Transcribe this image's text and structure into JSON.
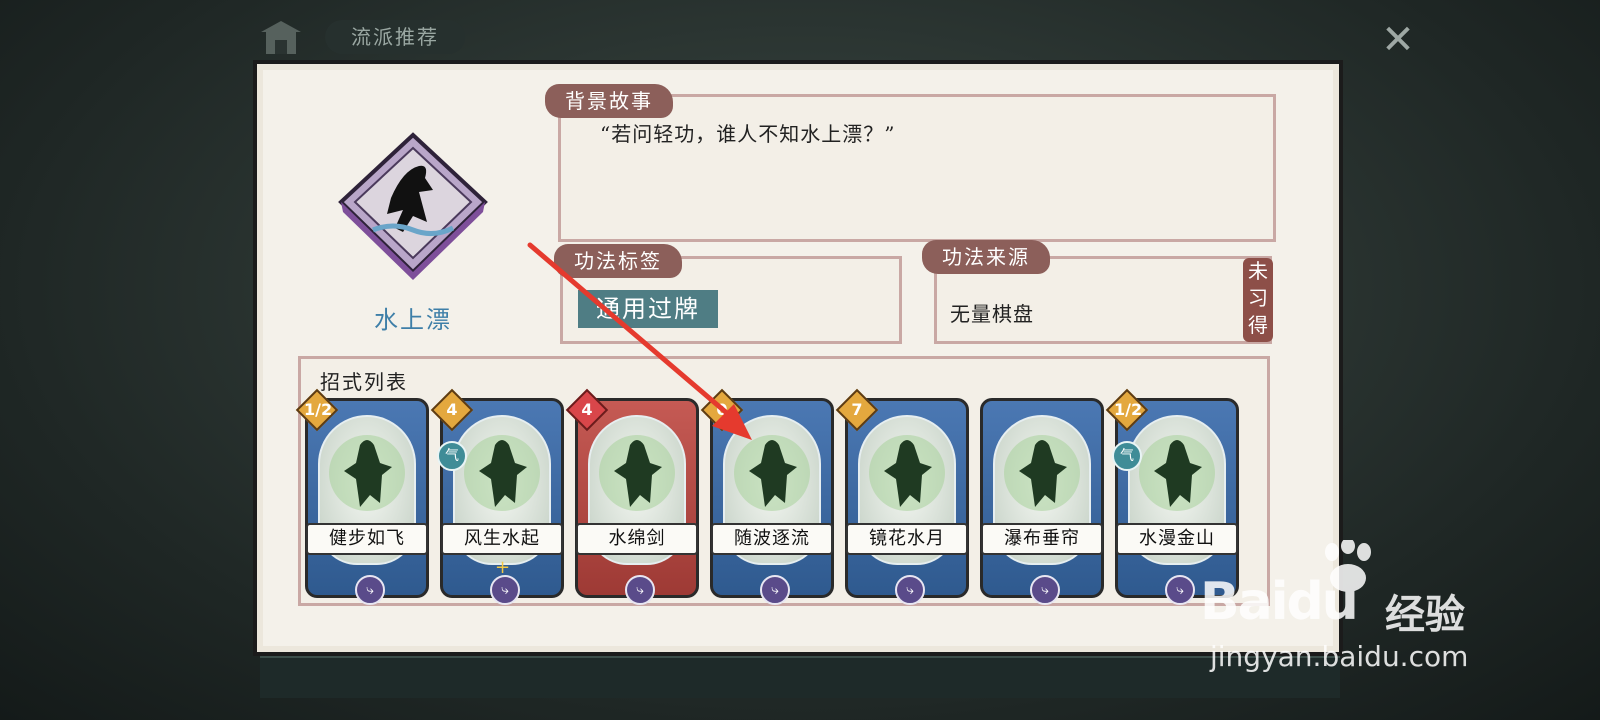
{
  "top_tab": {
    "label": "流派推荐"
  },
  "close_button": {
    "symbol": "✕"
  },
  "skill": {
    "name": "水上漂",
    "story_label": "背景故事",
    "story_text": "“若问轻功，谁人不知水上漂？”",
    "tags_label": "功法标签",
    "tag": "通用过牌",
    "source_label": "功法来源",
    "source": "无量棋盘",
    "status": "未习得"
  },
  "moves": {
    "title": "招式列表",
    "cards": [
      {
        "name": "健步如飞",
        "cost": "1/2",
        "color": "blue",
        "qi": false,
        "plus": false
      },
      {
        "name": "风生水起",
        "cost": "4",
        "color": "blue",
        "qi": true,
        "plus": true
      },
      {
        "name": "水绵剑",
        "cost": "4",
        "color": "red",
        "qi": false,
        "plus": false
      },
      {
        "name": "随波逐流",
        "cost": "0",
        "color": "blue",
        "qi": false,
        "plus": false
      },
      {
        "name": "镜花水月",
        "cost": "7",
        "color": "blue",
        "qi": false,
        "plus": false
      },
      {
        "name": "瀑布垂帘",
        "cost": "",
        "color": "blue",
        "qi": false,
        "plus": false
      },
      {
        "name": "水漫金山",
        "cost": "1/2",
        "color": "blue",
        "qi": true,
        "plus": false
      }
    ],
    "qi_symbol": "气",
    "plus_symbol": "+"
  },
  "watermark": {
    "logo": "Baidu",
    "cn": "经验",
    "url": "jingyan.baidu.com"
  },
  "colors": {
    "panel": "#f4f1ea",
    "ribbon": "#8c5f5a",
    "tag": "#4f7d84",
    "name": "#3e7fa8",
    "arrow": "#e53a2e"
  }
}
